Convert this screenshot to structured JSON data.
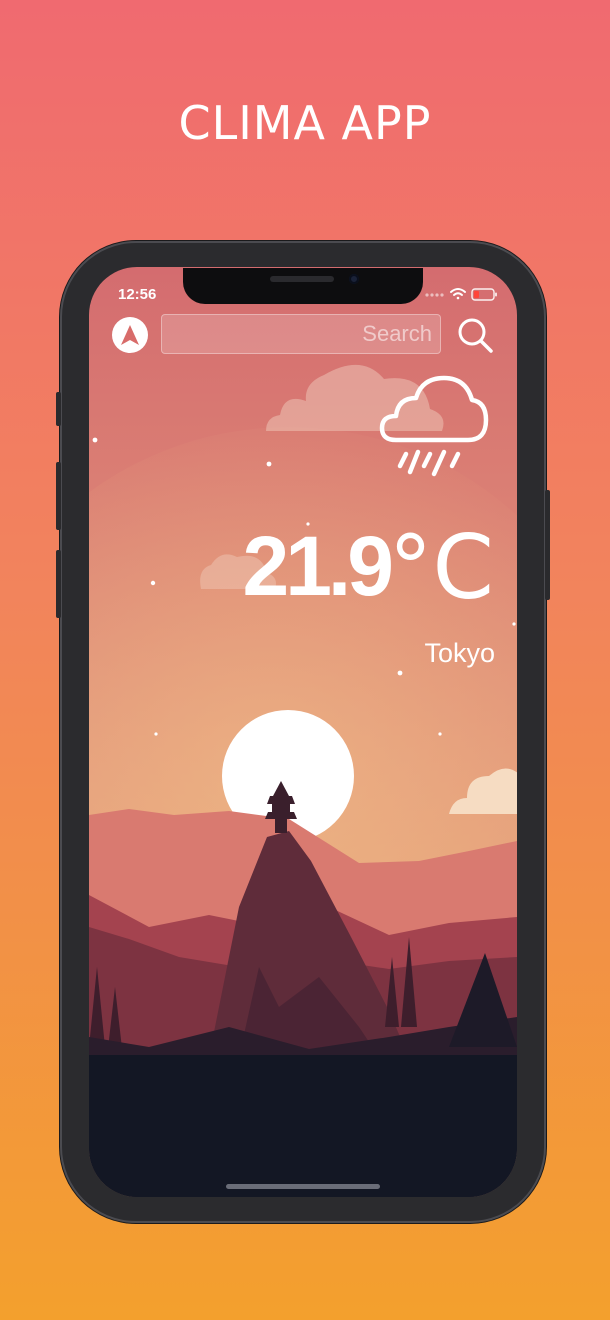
{
  "promo": {
    "title": "CLIMA APP"
  },
  "status_bar": {
    "time": "12:56"
  },
  "search": {
    "placeholder": "Search",
    "value": ""
  },
  "weather": {
    "temperature": "21.9",
    "unit": "°C",
    "city": "Tokyo",
    "condition_icon": "rain-cloud-icon"
  },
  "colors": {
    "bg_top": "#f06a70",
    "bg_bottom": "#f3a02d",
    "sky_top": "#d26a6e",
    "sky_bottom": "#e9b27a",
    "ground": "#131724"
  }
}
